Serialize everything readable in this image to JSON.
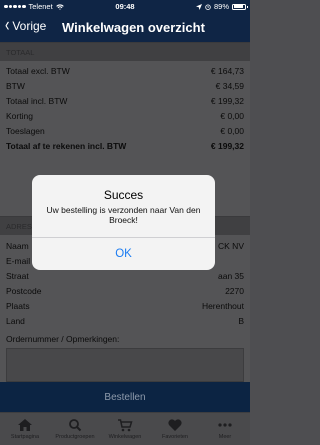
{
  "status": {
    "carrier": "Telenet",
    "time": "09:48",
    "battery": "89%",
    "battery_level": 0.89
  },
  "nav": {
    "back_label": "Vorige",
    "title": "Winkelwagen overzicht"
  },
  "totals": {
    "header": "TOTAAL",
    "rows": [
      {
        "label": "Totaal excl. BTW",
        "value": "€ 164,73",
        "bold": false
      },
      {
        "label": "BTW",
        "value": "€ 34,59",
        "bold": false
      },
      {
        "label": "Totaal incl. BTW",
        "value": "€ 199,32",
        "bold": false
      },
      {
        "label": "Korting",
        "value": "€ 0,00",
        "bold": false
      },
      {
        "label": "Toeslagen",
        "value": "€ 0,00",
        "bold": false
      },
      {
        "label": "Totaal af te rekenen incl. BTW",
        "value": "€ 199,32",
        "bold": true
      }
    ]
  },
  "address": {
    "header": "ADRES",
    "rows": [
      {
        "label": "Naam",
        "value": "CK NV"
      },
      {
        "label": "E-mail",
        "value": ""
      },
      {
        "label": "Straat",
        "value": "aan 35"
      },
      {
        "label": "Postcode",
        "value": "2270"
      },
      {
        "label": "Plaats",
        "value": "Herenthout"
      },
      {
        "label": "Land",
        "value": "B"
      }
    ],
    "orders_label": "Ordernummer / Opmerkingen:"
  },
  "order_button": "Bestellen",
  "tabs": [
    {
      "label": "Startpagina",
      "icon": "home-icon"
    },
    {
      "label": "Productgroepen",
      "icon": "search-icon"
    },
    {
      "label": "Winkelwagen",
      "icon": "cart-icon"
    },
    {
      "label": "Favorieten",
      "icon": "heart-icon"
    },
    {
      "label": "Meer",
      "icon": "more-icon"
    }
  ],
  "alert": {
    "title": "Succes",
    "message": "Uw bestelling is verzonden naar Van den Broeck!",
    "ok_label": "OK"
  },
  "colors": {
    "nav_bg": "#0f2545",
    "alert_button": "#1b7cf2"
  }
}
